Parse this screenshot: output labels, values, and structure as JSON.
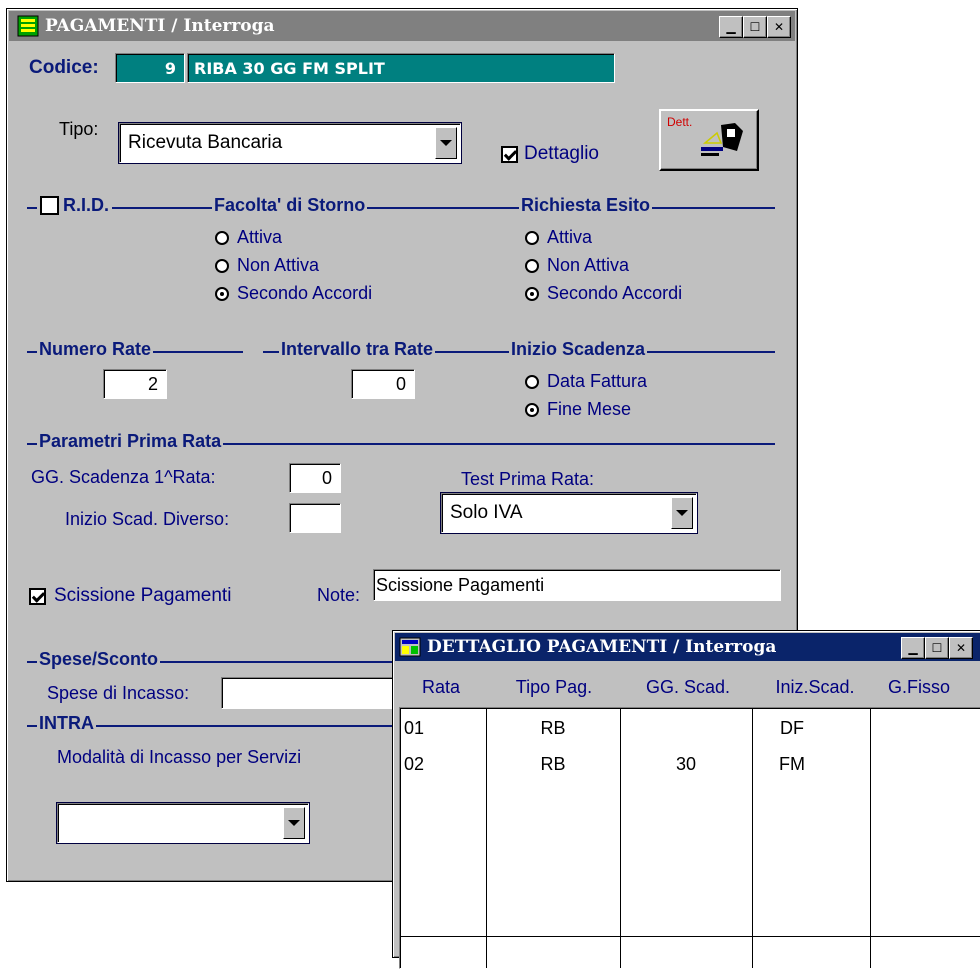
{
  "main_window": {
    "title": "PAGAMENTI / Interroga",
    "codice_label": "Codice:",
    "codice_number": "9",
    "codice_desc": "RIBA 30 GG FM SPLIT",
    "tipo_label": "Tipo:",
    "tipo_value": "Ricevuta Bancaria",
    "dettaglio_label": "Dettaglio",
    "dettaglio_checked": true,
    "dett_button_label": "Dett.",
    "rid_label": "R.I.D.",
    "rid_checked": false,
    "storno": {
      "title": "Facolta' di Storno",
      "options": [
        "Attiva",
        "Non Attiva",
        "Secondo Accordi"
      ],
      "selected": "Secondo Accordi"
    },
    "esito": {
      "title": "Richiesta Esito",
      "options": [
        "Attiva",
        "Non Attiva",
        "Secondo Accordi"
      ],
      "selected": "Secondo Accordi"
    },
    "numero_rate": {
      "title": "Numero Rate",
      "value": "2"
    },
    "intervallo": {
      "title": "Intervallo tra Rate",
      "value": "0"
    },
    "inizio_scadenza": {
      "title": "Inizio Scadenza",
      "options": [
        "Data Fattura",
        "Fine Mese"
      ],
      "selected": "Fine Mese"
    },
    "prima_rata": {
      "title": "Parametri Prima Rata",
      "gg_label": "GG. Scadenza 1^Rata:",
      "gg_value": "0",
      "inizio_label": "Inizio Scad. Diverso:",
      "inizio_value": "",
      "test_label": "Test Prima Rata:",
      "test_value": "Solo IVA"
    },
    "scissione_label": "Scissione Pagamenti",
    "scissione_checked": true,
    "note_label": "Note:",
    "note_value": "Scissione Pagamenti",
    "spese": {
      "title": "Spese/Sconto",
      "incasso_label": "Spese di Incasso:",
      "incasso_value": ""
    },
    "intra": {
      "title": "INTRA",
      "modalita_label": "Modalità di Incasso per Servizi",
      "modalita_value": ""
    }
  },
  "detail_window": {
    "title": "DETTAGLIO PAGAMENTI / Interroga",
    "columns": [
      "Rata",
      "Tipo Pag.",
      "GG. Scad.",
      "Iniz.Scad.",
      "G.Fisso"
    ],
    "rows": [
      [
        "01",
        "RB",
        "",
        "DF",
        ""
      ],
      [
        "02",
        "RB",
        "30",
        "FM",
        ""
      ]
    ]
  },
  "colors": {
    "title_active": "#0a246a",
    "title_inactive": "#808080",
    "window_bg": "#c0c0c0",
    "field_teal": "#008080",
    "group_title": "#0a1a7a"
  }
}
